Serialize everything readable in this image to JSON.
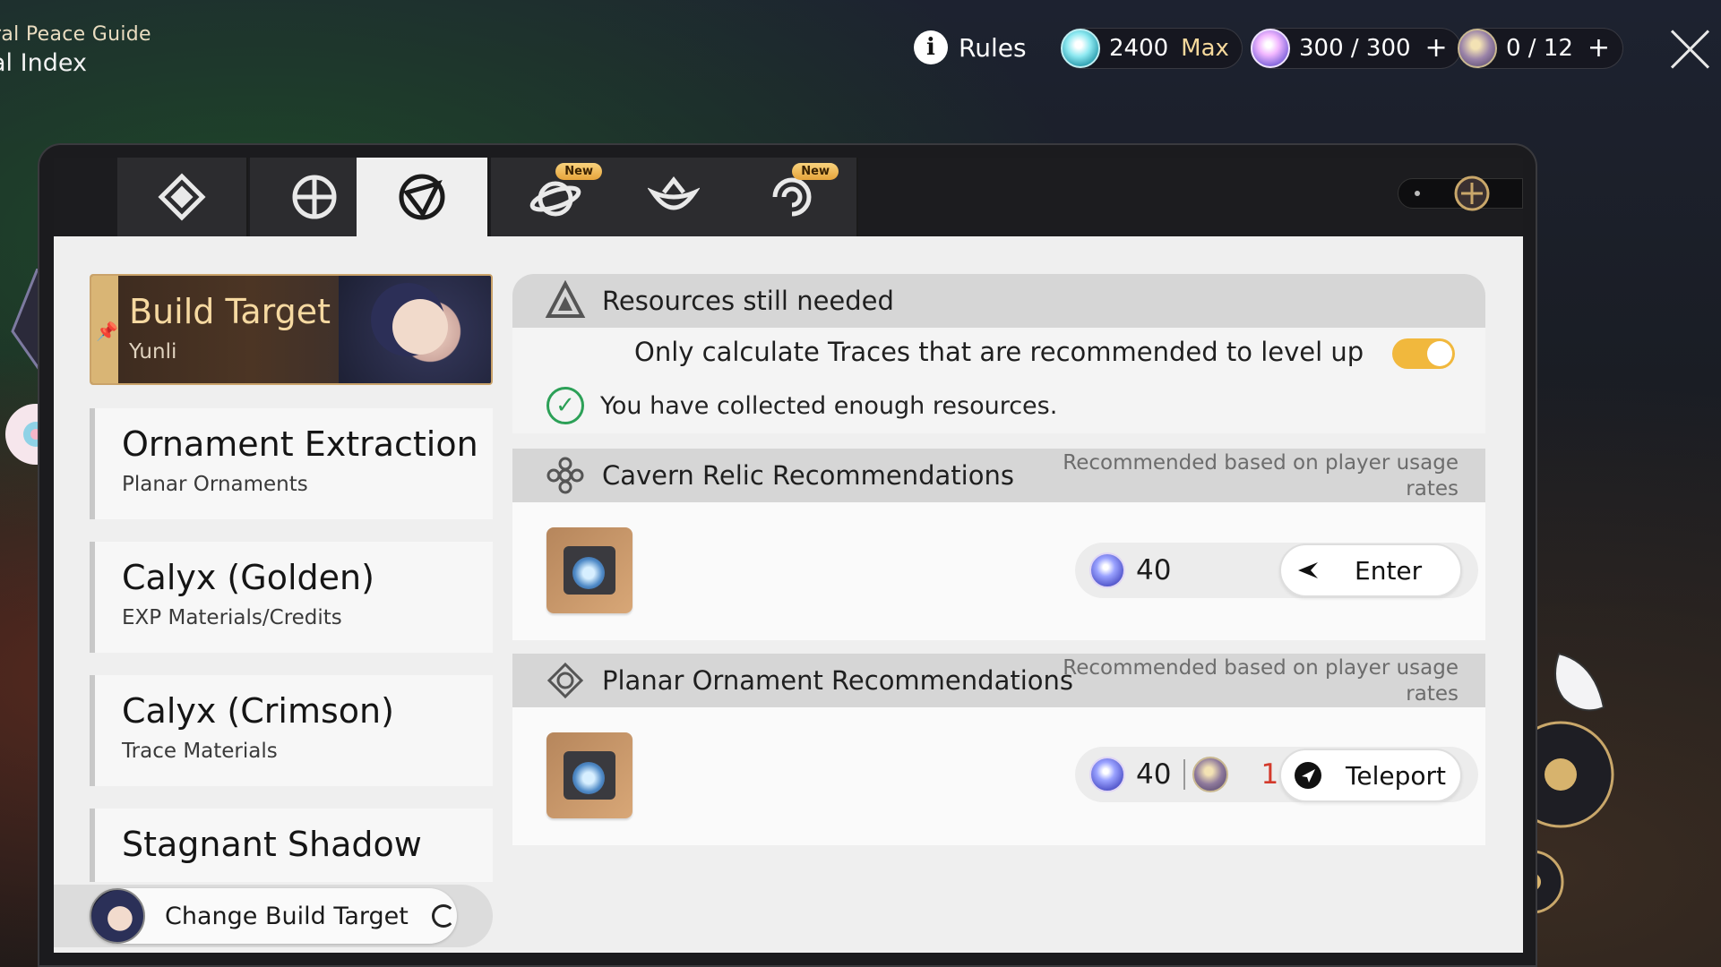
{
  "guide": {
    "line1": "ral Peace Guide",
    "line2": "al Index"
  },
  "topbar": {
    "rules_label": "Rules",
    "stellar_jade": {
      "value": "2400",
      "suffix": "Max"
    },
    "trailblaze_power": {
      "value": "300 / 300",
      "plus": "+"
    },
    "reserve": {
      "value": "0 / 12",
      "plus": "+"
    }
  },
  "tabs": [
    {
      "name": "tab-1",
      "icon": "diamond-icon"
    },
    {
      "name": "tab-2",
      "icon": "compass-icon"
    },
    {
      "name": "tab-3",
      "icon": "target-icon",
      "active": true
    },
    {
      "name": "tab-4",
      "icon": "planet-icon",
      "badge": "New"
    },
    {
      "name": "tab-5",
      "icon": "lotus-icon"
    },
    {
      "name": "tab-6",
      "icon": "swirl-icon",
      "badge": "New"
    }
  ],
  "sidebar": {
    "build_target": {
      "title": "Build Target",
      "character": "Yunli"
    },
    "items": [
      {
        "title": "Ornament Extraction",
        "sub": "Planar Ornaments"
      },
      {
        "title": "Calyx (Golden)",
        "sub": "EXP Materials/Credits"
      },
      {
        "title": "Calyx (Crimson)",
        "sub": "Trace Materials"
      },
      {
        "title": "Stagnant Shadow",
        "sub": ""
      }
    ],
    "change_build_label": "Change Build Target"
  },
  "resources": {
    "title": "Resources still needed",
    "toggle_label": "Only calculate Traces that are recommended to level up",
    "toggle_on": true,
    "status": "You have collected enough resources."
  },
  "cavern": {
    "title": "Cavern Relic Recommendations",
    "note_line1": "Recommended based on player usage",
    "note_line2": "rates",
    "cost": "40",
    "button": "Enter"
  },
  "planar": {
    "title": "Planar Ornament Recommendations",
    "note_line1": "Recommended based on player usage",
    "note_line2": "rates",
    "cost": "40",
    "cost2": "1",
    "button": "Teleport"
  },
  "colors": {
    "accent": "#f1b83d",
    "gold": "#d9b575",
    "success": "#2ca057",
    "alert": "#d33a2c"
  }
}
